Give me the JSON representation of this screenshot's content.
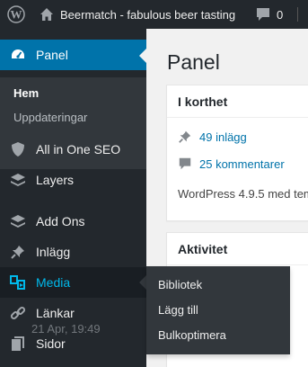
{
  "adminbar": {
    "site_title": "Beermatch - fabulous beer tasting",
    "comments_count": "0"
  },
  "sidebar": {
    "dashboard_label": "Panel",
    "dashboard_submenu": [
      "Hem",
      "Uppdateringar"
    ],
    "items": [
      {
        "label": "All in One SEO",
        "icon": "shield-icon"
      },
      {
        "label": "Layers",
        "icon": "layers-icon"
      },
      {
        "label": "Add Ons",
        "icon": "addons-icon"
      },
      {
        "label": "Inlägg",
        "icon": "pin-icon"
      },
      {
        "label": "Media",
        "icon": "media-icon"
      },
      {
        "label": "Länkar",
        "icon": "link-icon"
      },
      {
        "label": "Sidor",
        "icon": "pages-icon"
      }
    ]
  },
  "media_flyout": [
    "Bibliotek",
    "Lägg till",
    "Bulkoptimera"
  ],
  "main": {
    "page_title": "Panel",
    "glance": {
      "title": "I korthet",
      "posts": "49 inlägg",
      "comments": "25 kommentarer",
      "wp_version": "WordPress 4.9.5 med tem"
    },
    "activity": {
      "title": "Aktivitet",
      "date": "21 Apr, 19:49"
    }
  },
  "colors": {
    "adminbar_bg": "#23282d",
    "active_menu": "#0073aa",
    "hover_highlight": "#00b9eb",
    "link": "#0073aa"
  }
}
